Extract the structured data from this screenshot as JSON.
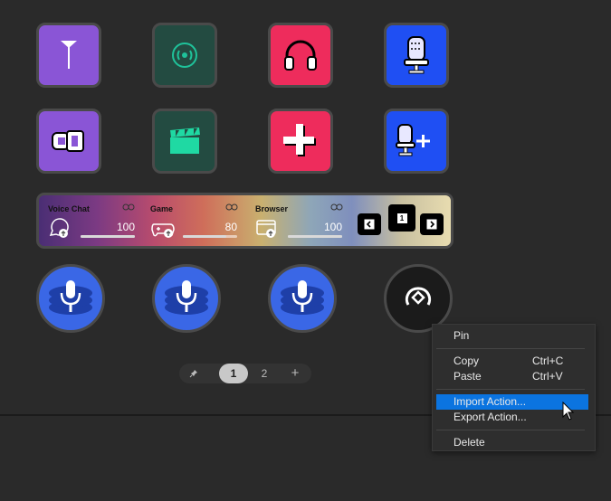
{
  "keys": [
    {
      "name": "antenna",
      "color": "#8a55d6"
    },
    {
      "name": "broadcast",
      "color": "#234b41"
    },
    {
      "name": "headphones",
      "color": "#ee2c5c"
    },
    {
      "name": "microphone",
      "color": "#1f4ff3"
    },
    {
      "name": "stream-logo",
      "color": "#8a55d6"
    },
    {
      "name": "clapperboard",
      "color": "#234b41"
    },
    {
      "name": "plus",
      "color": "#ee2c5c"
    },
    {
      "name": "microphone-plus",
      "color": "#1f4ff3"
    }
  ],
  "mixer": {
    "channels": [
      {
        "label": "Voice Chat",
        "value": "100",
        "level": 1.0,
        "icon": "chat-icon"
      },
      {
        "label": "Game",
        "value": "80",
        "level": 0.8,
        "icon": "gamepad-icon"
      },
      {
        "label": "Browser",
        "value": "100",
        "level": 1.0,
        "icon": "browser-icon"
      }
    ],
    "page_number": "1"
  },
  "dials": [
    {
      "name": "mic-dial-1",
      "color": "#3a67e6"
    },
    {
      "name": "mic-dial-2",
      "color": "#3a67e6"
    },
    {
      "name": "mic-dial-3",
      "color": "#3a67e6"
    },
    {
      "name": "empty-dial",
      "color": "#1b1b1b"
    }
  ],
  "pager": {
    "page1": "1",
    "page2": "2",
    "add": "+"
  },
  "context_menu": {
    "pin": "Pin",
    "copy": "Copy",
    "copy_shortcut": "Ctrl+C",
    "paste": "Paste",
    "paste_shortcut": "Ctrl+V",
    "import": "Import Action...",
    "export": "Export Action...",
    "delete": "Delete"
  },
  "colors": {
    "accent": "#0b74e0",
    "background": "#2a2a2a"
  }
}
